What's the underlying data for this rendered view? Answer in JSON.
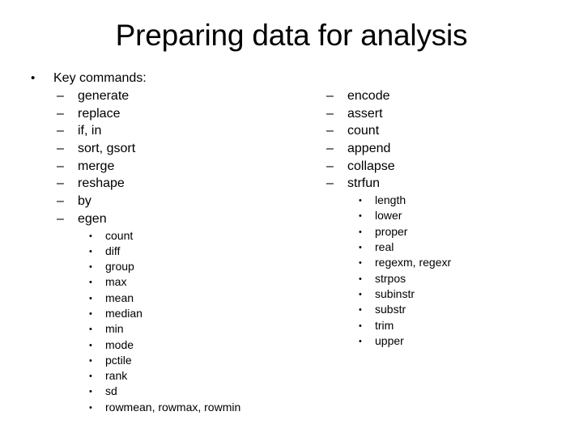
{
  "slide": {
    "title": "Preparing data for analysis",
    "background_color": "#ffffff",
    "text_color": "#000000"
  },
  "markers": {
    "level1": "•",
    "level2": "–",
    "level3": "•"
  },
  "content": {
    "level1_bullet": "Key commands:",
    "left_column": {
      "items": [
        {
          "label": "generate"
        },
        {
          "label": "replace"
        },
        {
          "label": "if, in"
        },
        {
          "label": "sort, gsort"
        },
        {
          "label": "merge"
        },
        {
          "label": "reshape"
        },
        {
          "label": "by"
        },
        {
          "label": "egen"
        }
      ],
      "sub_items": [
        "count",
        "diff",
        "group",
        "max",
        "mean",
        "median",
        "min",
        "mode",
        "pctile",
        "rank",
        "sd",
        "rowmean, rowmax, rowmin"
      ]
    },
    "right_column": {
      "items": [
        {
          "label": "encode"
        },
        {
          "label": "assert"
        },
        {
          "label": "count"
        },
        {
          "label": "append"
        },
        {
          "label": "collapse"
        },
        {
          "label": "strfun"
        }
      ],
      "sub_items": [
        "length",
        "lower",
        "proper",
        "real",
        "regexm, regexr",
        "strpos",
        "subinstr",
        "substr",
        "trim",
        "upper"
      ]
    }
  }
}
